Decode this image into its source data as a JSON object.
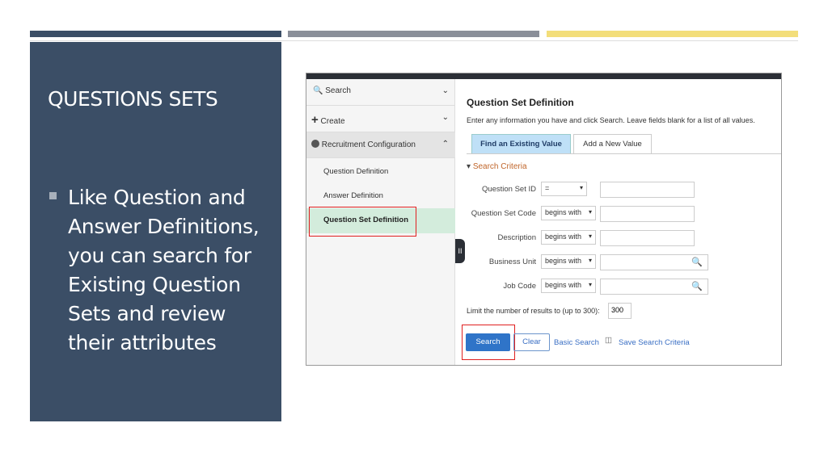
{
  "slide": {
    "title": "QUESTIONS SETS",
    "bullet": "Like Question and Answer Definitions, you can search for Existing Question Sets and review their attributes",
    "colors": {
      "panel": "#3b4e66",
      "bar1": "#3b4e66",
      "bar2": "#8a8f99",
      "bar3": "#f3de7a"
    }
  },
  "nav": {
    "items": [
      {
        "label": "Search",
        "icon": "search-icon"
      },
      {
        "label": "Create",
        "icon": "plus-icon"
      },
      {
        "label": "Recruitment Configuration",
        "icon": "gear-icon"
      }
    ],
    "sub": [
      "Question Definition",
      "Answer Definition",
      "Question Set Definition"
    ]
  },
  "main": {
    "title": "Question Set Definition",
    "instructions": "Enter any information you have and click Search. Leave fields blank for a list of all values.",
    "tabs": [
      "Find an Existing Value",
      "Add a New Value"
    ],
    "section": "Search Criteria",
    "fields": [
      {
        "label": "Question Set ID",
        "op": "="
      },
      {
        "label": "Question Set Code",
        "op": "begins with"
      },
      {
        "label": "Description",
        "op": "begins with"
      },
      {
        "label": "Business Unit",
        "op": "begins with"
      },
      {
        "label": "Job Code",
        "op": "begins with"
      }
    ],
    "limit_label": "Limit the number of results to (up to 300):",
    "limit_value": "300",
    "search": "Search",
    "clear": "Clear",
    "basic": "Basic Search",
    "save": "Save Search Criteria"
  }
}
